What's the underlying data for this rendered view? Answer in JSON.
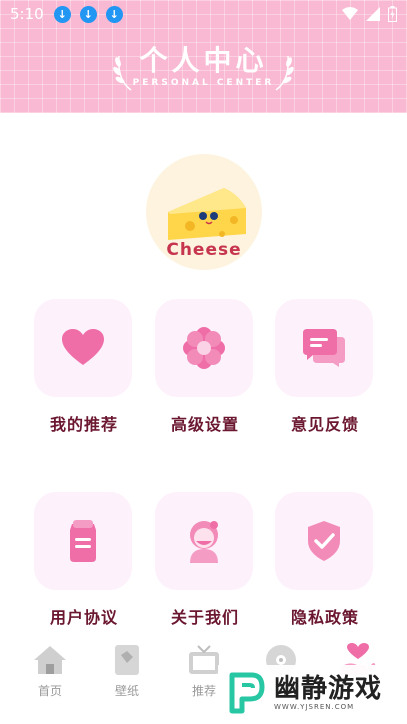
{
  "status_bar": {
    "time": "5:10",
    "download_icon_count": 3
  },
  "header": {
    "title": "个人中心",
    "subtitle": "PERSONAL CENTER"
  },
  "profile": {
    "avatar_label": "Cheese"
  },
  "menu": {
    "items": [
      {
        "label": "我的推荐",
        "icon": "heart-icon"
      },
      {
        "label": "高级设置",
        "icon": "flower-icon"
      },
      {
        "label": "意见反馈",
        "icon": "chat-bubbles-icon"
      },
      {
        "label": "用户协议",
        "icon": "document-icon"
      },
      {
        "label": "关于我们",
        "icon": "girl-avatar-icon"
      },
      {
        "label": "隐私政策",
        "icon": "shield-check-icon"
      }
    ]
  },
  "bottom_nav": {
    "items": [
      {
        "label": "首页",
        "icon": "home-icon"
      },
      {
        "label": "壁纸",
        "icon": "wallpaper-icon"
      },
      {
        "label": "推荐",
        "icon": "tv-icon"
      },
      {
        "label": "",
        "icon": "disc-icon"
      },
      {
        "label": "",
        "icon": "hand-heart-icon"
      }
    ]
  },
  "watermark": {
    "brand": "幽静游戏",
    "url": "WWW.YJSREN.COM"
  },
  "colors": {
    "header_pink": "#f9b9d3",
    "card_bg": "#fdf1fb",
    "icon_pink": "#ef6ea8",
    "label_dark": "#6b1730"
  }
}
